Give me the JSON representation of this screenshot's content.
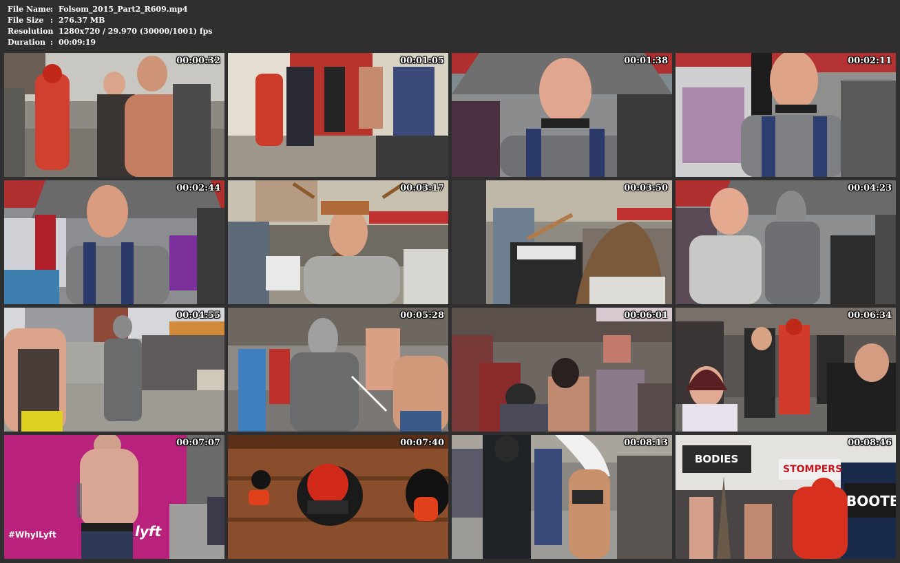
{
  "info": {
    "rows": [
      {
        "label": "File Name",
        "value": "Folsom_2015_Part2_R609.mp4"
      },
      {
        "label": "File Size",
        "value": "276.37 MB"
      },
      {
        "label": "Resolution",
        "value": "1280x720 / 29.970 (30000/1001) fps"
      },
      {
        "label": "Duration",
        "value": "00:09:19"
      }
    ],
    "separator": ":"
  },
  "thumbnails": [
    {
      "time": "00:00:32",
      "scene": "street-crowd-red-suit"
    },
    {
      "time": "00:01:05",
      "scene": "sidewalk-uniforms"
    },
    {
      "time": "00:01:38",
      "scene": "bald-man-smiling"
    },
    {
      "time": "00:02:11",
      "scene": "bald-man-harness"
    },
    {
      "time": "00:02:44",
      "scene": "bald-man-looking-down"
    },
    {
      "time": "00:03:17",
      "scene": "antler-man-talking"
    },
    {
      "time": "00:03:50",
      "scene": "street-booths"
    },
    {
      "time": "00:04:23",
      "scene": "man-and-masked-figure"
    },
    {
      "time": "00:04:55",
      "scene": "masked-figure-street"
    },
    {
      "time": "00:05:28",
      "scene": "masked-figure-crowd"
    },
    {
      "time": "00:06:01",
      "scene": "dense-crowd"
    },
    {
      "time": "00:06:34",
      "scene": "crowd-red-figure"
    },
    {
      "time": "00:07:07",
      "scene": "magenta-wall",
      "signs": [
        "#WhyILyft",
        "lyft"
      ]
    },
    {
      "time": "00:07:40",
      "scene": "wooden-stocks"
    },
    {
      "time": "00:08:13",
      "scene": "leather-crowd"
    },
    {
      "time": "00:08:46",
      "scene": "storefront",
      "signs": [
        "BODIES",
        "STOMPERS",
        "BOOTB"
      ]
    }
  ]
}
